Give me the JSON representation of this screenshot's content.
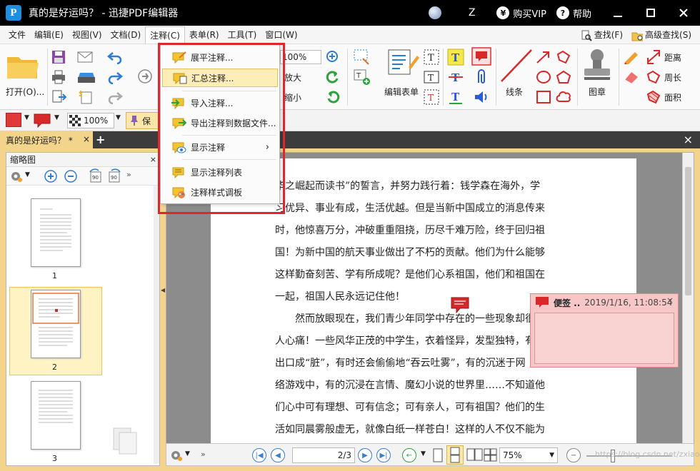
{
  "window": {
    "title": "真的是好运吗？ - 迅捷PDF编辑器",
    "logo_letter": "P",
    "user": "Z",
    "vip_symbol": "¥",
    "buy_vip": "购买VIP",
    "help_symbol": "?",
    "help": "帮助"
  },
  "menubar": {
    "items": [
      "文件",
      "编辑(E)",
      "视图(V)",
      "文档(D)",
      "注释(C)",
      "表单(R)",
      "工具(T)",
      "窗口(W)"
    ],
    "find": "查找(F)",
    "advanced_find": "高级查找(S)"
  },
  "ribbon": {
    "open": "打开(O)...",
    "zoom_in": "放大",
    "zoom_out": "缩小",
    "edit_form": "编辑表单",
    "line": "线条",
    "stamp": "图章",
    "distance": "距离",
    "perimeter": "周长",
    "area": "面积",
    "zoom_value": "100%"
  },
  "toolrow2": {
    "pin_label": "保"
  },
  "tab": {
    "name": "真的是好运吗？ *",
    "close": "×",
    "add": "+",
    "pane_close": "×"
  },
  "thumbnails": {
    "title": "缩略图",
    "close": "×",
    "pages": [
      "1",
      "2",
      "3"
    ],
    "selected_page": 2
  },
  "dropdown": {
    "items": [
      {
        "label": "展平注释...",
        "highlight": false
      },
      {
        "label": "汇总注释...",
        "highlight": true
      },
      {
        "label": "导入注释...",
        "highlight": false
      },
      {
        "label": "导出注释到数据文件...",
        "highlight": false
      },
      {
        "label": "显示注释",
        "highlight": false,
        "submenu": "›"
      },
      {
        "label": "显示注释列表",
        "highlight": false
      },
      {
        "label": "注释样式调板",
        "highlight": false
      }
    ]
  },
  "document": {
    "lines": [
      "华之崛起而读书”的誓言，并努力践行着：钱学森在海外，学",
      "习优异、事业有成，生活优越。但是当新中国成立的消息传来",
      "时，他惊喜万分，冲破重重阻挠，历尽千难万险，终于回归祖",
      "国！为新中国的航天事业做出了不朽的贡献。他们为什么能够",
      "这样勤奋刻苦、学有所成呢？是他们心系祖国，他们和祖国在",
      "一起，祖国人民永远记住他！",
      "　　然而放眼现在，我们青少年同学中存在的一些现象却很令",
      "人心痛！一些风华正茂的中学生，衣着怪异，发型独特，有时",
      "出口成“脏”，有时还会偷偷地“吞云吐雾”，有的沉迷于网",
      "络游戏中，有的沉浸在言情、魔幻小说的世界里……不知道他",
      "们心中可有理想、可有信念；可有亲人，可有祖国？他们的生",
      "活如同晨雾般虚无，就像白纸一样苍白！这样的人不仅不能为"
    ]
  },
  "sticky_note": {
    "label": "便签 ..",
    "timestamp": "2019/1/16, 11:08:54",
    "close": "×"
  },
  "statusbar": {
    "page_display": "2/3",
    "zoom": "75%",
    "watermark": "https://blog.csdn.net/zxiaoxiao..."
  },
  "colors": {
    "accent_red": "#e0262b",
    "highlight_yellow": "#fdeeb8",
    "tab_yellow": "#f2d48a",
    "note_pink": "#f7c6c6"
  }
}
